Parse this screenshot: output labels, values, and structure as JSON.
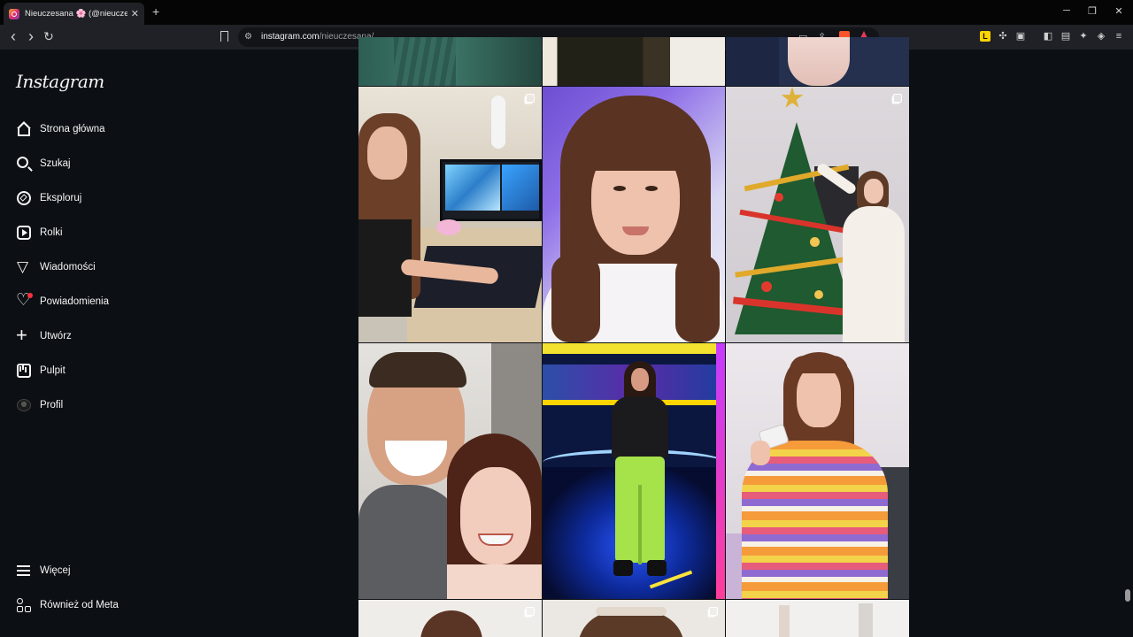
{
  "browser": {
    "tab_title": "Nieuczesana 🌸 (@nieuczesana)",
    "tab_close": "✕",
    "new_tab": "+",
    "window_controls": {
      "minimize": "─",
      "maximize": "❐",
      "close": "✕"
    },
    "nav": {
      "back": "‹",
      "forward": "›",
      "reload": "↻"
    },
    "url_host": "instagram.com",
    "url_path": "/nieuczesana/"
  },
  "instagram": {
    "logo": "Instagram",
    "nav_items": [
      {
        "label": "Strona główna",
        "icon": "home-icon"
      },
      {
        "label": "Szukaj",
        "icon": "search-icon"
      },
      {
        "label": "Eksploruj",
        "icon": "compass-icon"
      },
      {
        "label": "Rolki",
        "icon": "reels-icon"
      },
      {
        "label": "Wiadomości",
        "icon": "messages-icon"
      },
      {
        "label": "Powiadomienia",
        "icon": "heart-icon"
      },
      {
        "label": "Utwórz",
        "icon": "plus-icon"
      },
      {
        "label": "Pulpit",
        "icon": "dashboard-icon"
      },
      {
        "label": "Profil",
        "icon": "avatar-icon"
      }
    ],
    "bottom_items": [
      {
        "label": "Więcej",
        "icon": "menu-icon"
      },
      {
        "label": "Również od Meta",
        "icon": "meta-apps-icon"
      }
    ],
    "notification_dot_color": "#ff3040"
  },
  "posts": [
    {
      "description": "partial-top-green",
      "multi": false
    },
    {
      "description": "partial-top-dark",
      "multi": false
    },
    {
      "description": "partial-top-blue",
      "multi": false
    },
    {
      "description": "girl-at-gaming-desk",
      "multi": true
    },
    {
      "description": "selfie-purple-light",
      "multi": false
    },
    {
      "description": "christmas-tree",
      "multi": true
    },
    {
      "description": "selfie-with-man",
      "multi": false
    },
    {
      "description": "tv-studio-neon",
      "multi": false
    },
    {
      "description": "striped-sweater-card",
      "multi": false
    },
    {
      "description": "partial-bottom-1",
      "multi": true
    },
    {
      "description": "partial-bottom-2",
      "multi": true
    },
    {
      "description": "partial-bottom-3",
      "multi": false
    }
  ]
}
